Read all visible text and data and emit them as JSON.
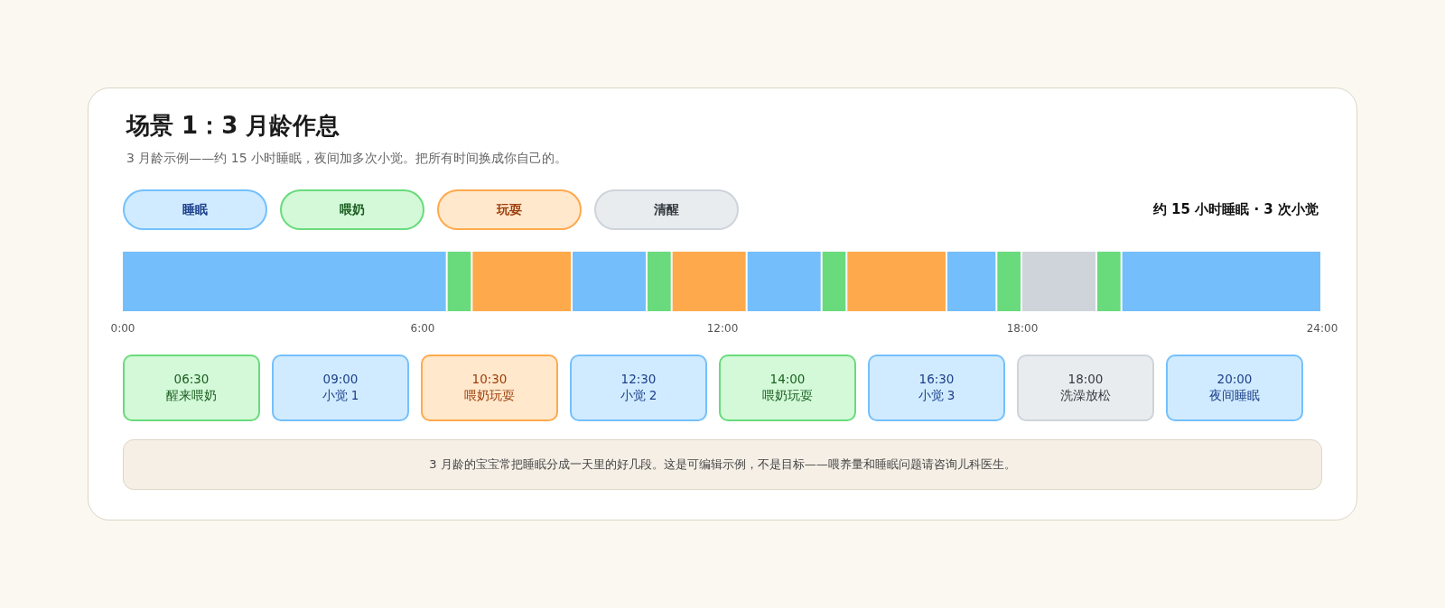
{
  "title": "场景 1：3 月龄作息",
  "subtitle": "3 月龄示例——约 15 小时睡眠，夜间加多次小觉。把所有时间换成你自己的。",
  "legend": [
    {
      "kind": "sleep",
      "label": "睡眠"
    },
    {
      "kind": "feed",
      "label": "喂奶"
    },
    {
      "kind": "play",
      "label": "玩耍"
    },
    {
      "kind": "awake",
      "label": "清醒"
    }
  ],
  "summary": "约 15 小时睡眠 · 3 次小觉",
  "timeline": {
    "chart_data": {
      "type": "bar",
      "orientation": "horizontal",
      "stacked": true,
      "xlim": [
        0,
        24
      ],
      "xticks": [
        {
          "value": 0,
          "label": "0:00"
        },
        {
          "value": 6,
          "label": "6:00"
        },
        {
          "value": 12,
          "label": "12:00"
        },
        {
          "value": 18,
          "label": "18:00"
        },
        {
          "value": 24,
          "label": "24:00"
        }
      ],
      "series": [
        {
          "color": "#74bffb",
          "values": [
            6.5
          ]
        },
        {
          "color": "#69db7c",
          "values": [
            0.5
          ]
        },
        {
          "color": "#ffa94d",
          "values": [
            2
          ]
        },
        {
          "color": "#74bffb",
          "values": [
            1.5
          ]
        },
        {
          "color": "#69db7c",
          "values": [
            0.5
          ]
        },
        {
          "color": "#ffa94d",
          "values": [
            1.5
          ]
        },
        {
          "color": "#74bffb",
          "values": [
            1.5
          ]
        },
        {
          "color": "#69db7c",
          "values": [
            0.5
          ]
        },
        {
          "color": "#ffa94d",
          "values": [
            2
          ]
        },
        {
          "color": "#74bffb",
          "values": [
            1
          ]
        },
        {
          "color": "#69db7c",
          "values": [
            0.5
          ]
        },
        {
          "color": "#ced4da",
          "values": [
            1.5
          ]
        },
        {
          "color": "#69db7c",
          "values": [
            0.5
          ]
        },
        {
          "color": "#74bffb",
          "values": [
            4
          ]
        }
      ]
    }
  },
  "events": [
    {
      "kind": "feed",
      "time": "06:30",
      "label": "醒来喂奶"
    },
    {
      "kind": "sleep",
      "time": "09:00",
      "label": "小觉 1"
    },
    {
      "kind": "play",
      "time": "10:30",
      "label": "喂奶玩耍"
    },
    {
      "kind": "sleep",
      "time": "12:30",
      "label": "小觉 2"
    },
    {
      "kind": "feed",
      "time": "14:00",
      "label": "喂奶玩耍"
    },
    {
      "kind": "sleep",
      "time": "16:30",
      "label": "小觉 3"
    },
    {
      "kind": "awake",
      "time": "18:00",
      "label": "洗澡放松"
    },
    {
      "kind": "sleep",
      "time": "20:00",
      "label": "夜间睡眠"
    }
  ],
  "note": "3 月龄的宝宝常把睡眠分成一天里的好几段。这是可编辑示例，不是目标——喂养量和睡眠问题请咨询儿科医生。"
}
